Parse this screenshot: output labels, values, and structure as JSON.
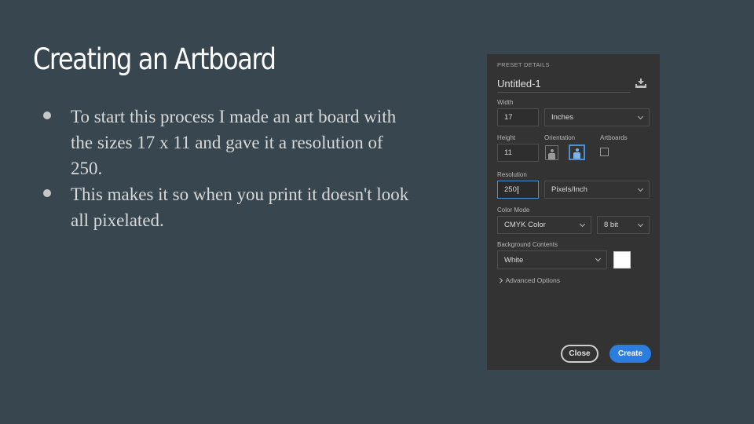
{
  "slide": {
    "title": "Creating an Artboard",
    "bullets": [
      "To start this process I made an art board with the sizes 17 x 11 and gave it a resolution of 250.",
      "This makes it so when you print it doesn't look all pixelated."
    ]
  },
  "dialog": {
    "section_title": "PRESET DETAILS",
    "document_name": "Untitled-1",
    "save_preset_icon": "save-preset-icon",
    "width": {
      "label": "Width",
      "value": "17",
      "unit": "Inches"
    },
    "height": {
      "label": "Height",
      "value": "11"
    },
    "orientation": {
      "label": "Orientation",
      "selected": "landscape"
    },
    "artboards": {
      "label": "Artboards",
      "checked": false
    },
    "resolution": {
      "label": "Resolution",
      "value": "250",
      "unit": "Pixels/Inch"
    },
    "color_mode": {
      "label": "Color Mode",
      "value": "CMYK Color",
      "bit_depth": "8 bit"
    },
    "background": {
      "label": "Background Contents",
      "value": "White",
      "swatch_color": "#ffffff"
    },
    "advanced_label": "Advanced Options",
    "close_label": "Close",
    "create_label": "Create",
    "accent_color": "#2b7de0"
  }
}
